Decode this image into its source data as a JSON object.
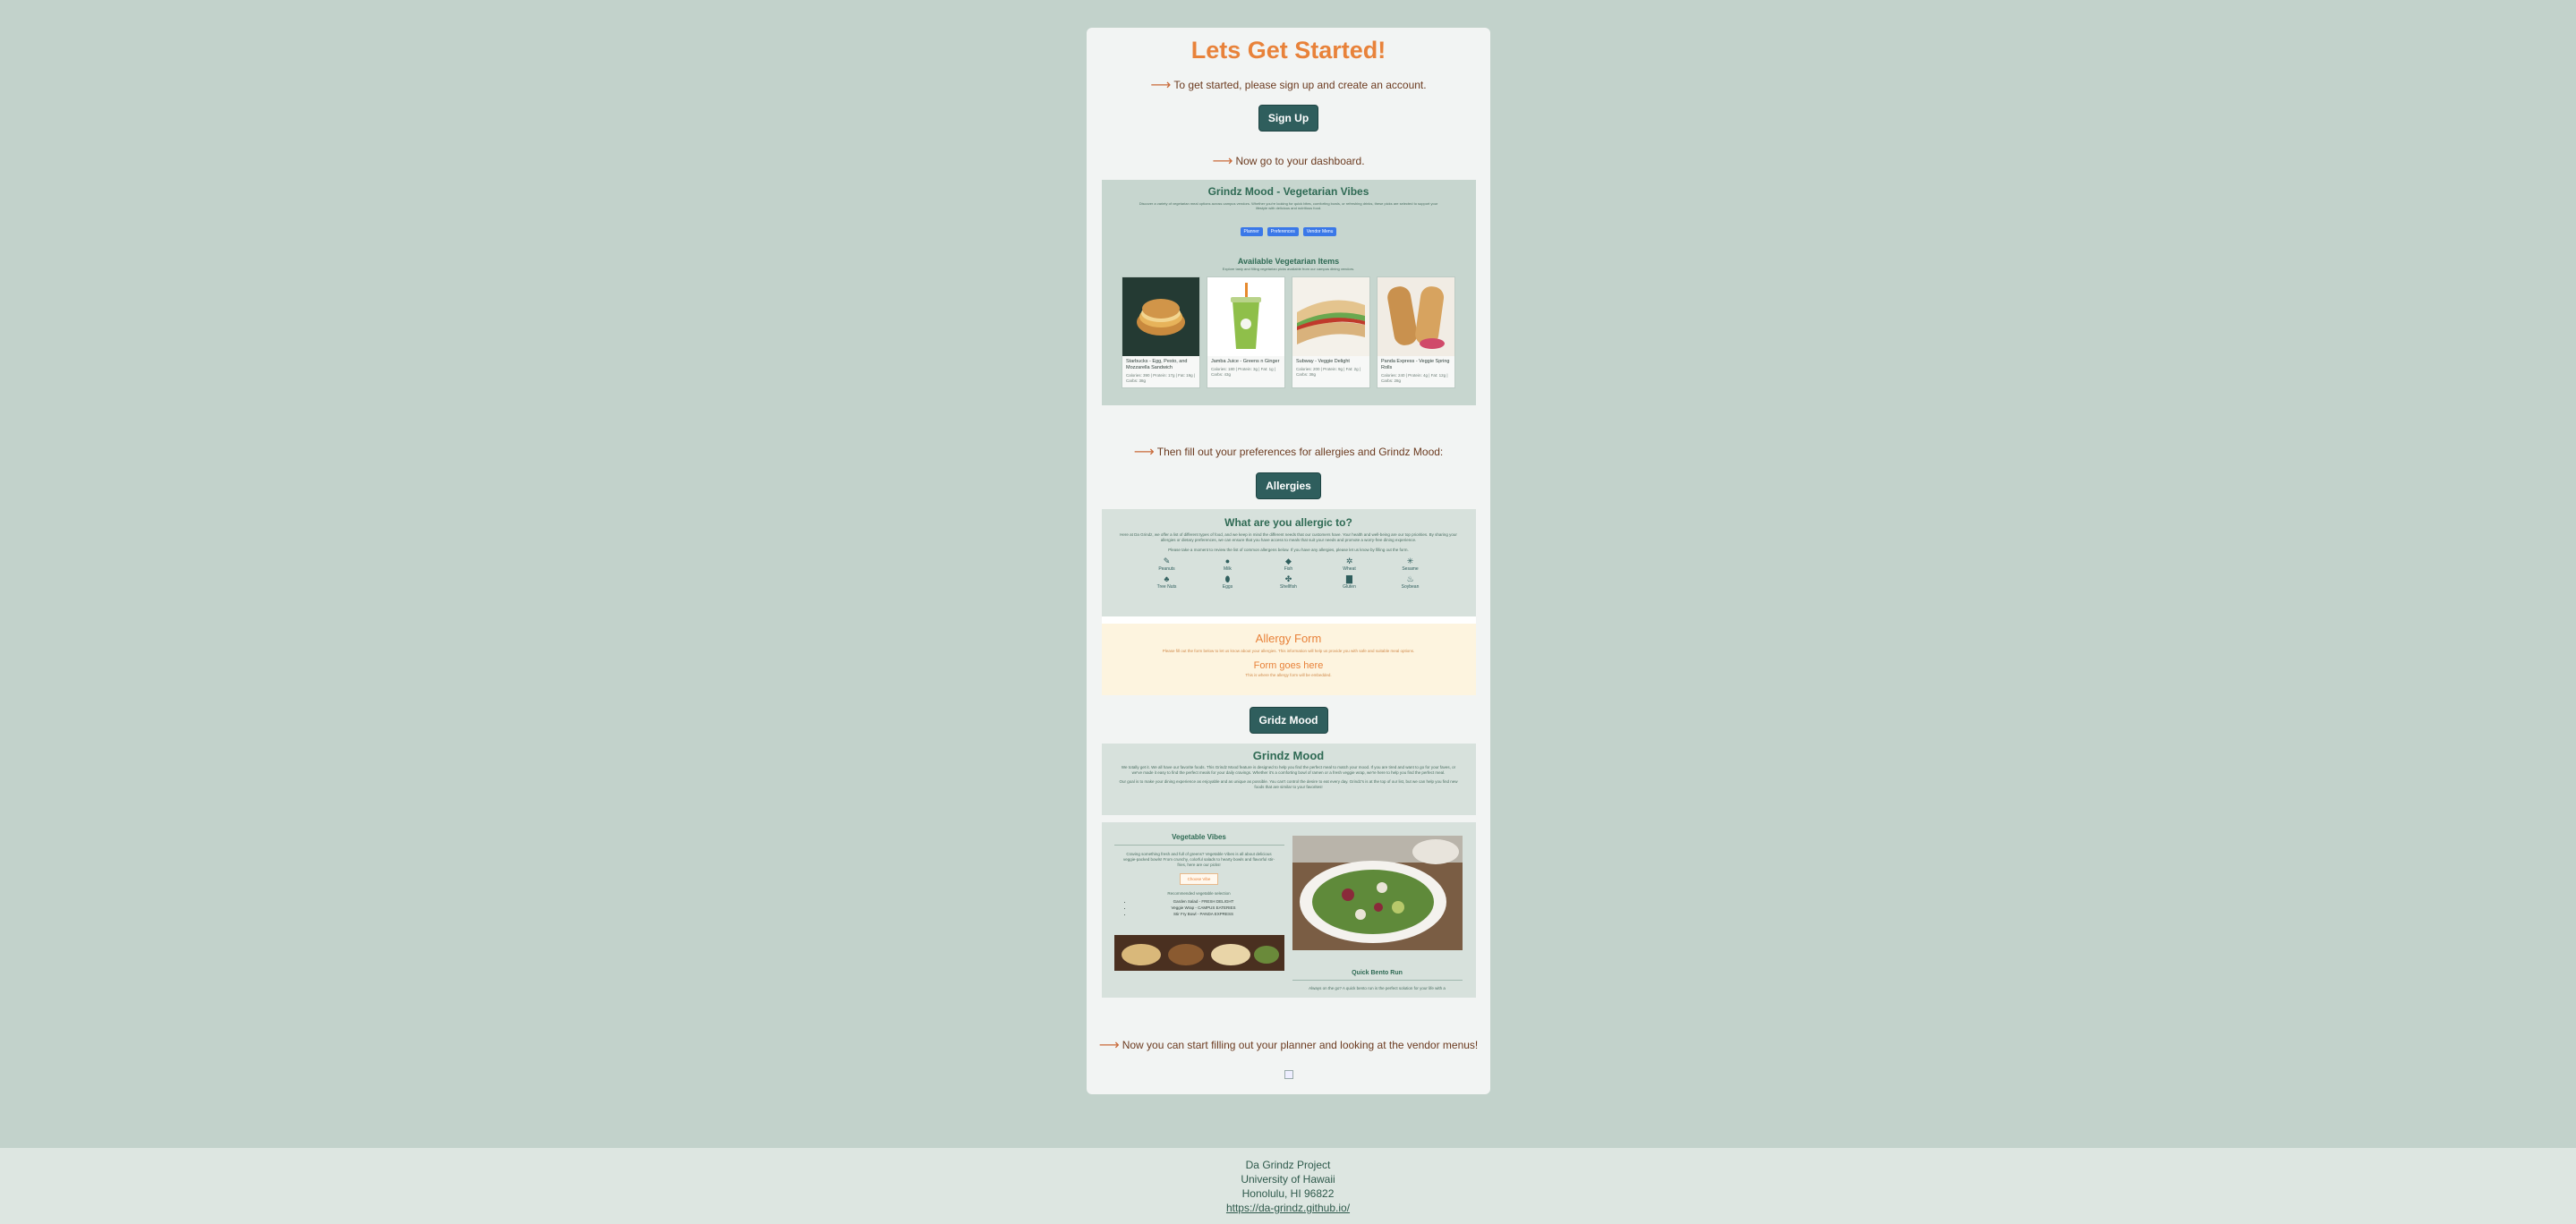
{
  "page": {
    "heading": "Lets Get Started!",
    "step1": "To get started, please sign up and create an account.",
    "signup_button": "Sign Up",
    "step2": "Now go to your dashboard.",
    "step3": "Then fill out your preferences for allergies and Grindz Mood:",
    "allergies_button": "Allergies",
    "gm_button": "Gridz Mood",
    "step4": "Now you can start filling out your planner and looking at the vendor menus!"
  },
  "dashboard": {
    "title": "Grindz Mood - Vegetarian Vibes",
    "intro": "Discover a variety of vegetarian meal options across campus vendors. Whether you're looking for quick bites, comforting bowls, or refreshing drinks, these picks are selected to support your lifestyle with delicious and nutritious food.",
    "chips": [
      "Planner",
      "Preferences",
      "Vendor Menu"
    ],
    "section_title": "Available Vegetarian Items",
    "section_sub": "Explore tasty and filling vegetarian picks available from our campus dining vendors.",
    "items": [
      {
        "name": "Starbucks - Egg, Pesto, and Mozzarella Sandwich",
        "meta": "Calories: 390 | Protein: 17g | Fat: 19g | Carbs: 38g"
      },
      {
        "name": "Jamba Juice - Greens n Ginger",
        "meta": "Calories: 180 | Protein: 3g | Fat: 1g | Carbs: 43g"
      },
      {
        "name": "Subway - Veggie Delight",
        "meta": "Calories: 200 | Protein: 9g | Fat: 2g | Carbs: 38g"
      },
      {
        "name": "Panda Express - Veggie Spring Rolls",
        "meta": "Calories: 240 | Protein: 4g | Fat: 12g | Carbs: 28g"
      }
    ]
  },
  "allergy_panel": {
    "title": "What are you allergic to?",
    "intro": "Here at Da Grindz, we offer a list of different types of food, and we keep in mind the different needs that our customers have. Your health and well-being are our top priorities. By sharing your allergies or dietary preferences, we can ensure that you have access to meals that suit your needs and promote a worry-free dining experience.",
    "note": "Please take a moment to review the list of common allergens below. If you have any allergies, please let us know by filling out the form.",
    "allergens": [
      "Peanuts",
      "Milk",
      "Fish",
      "Wheat",
      "Sesame",
      "Tree Nuts",
      "Eggs",
      "Shellfish",
      "Gluten",
      "Soybean"
    ]
  },
  "allergy_form": {
    "title": "Allergy Form",
    "desc": "Please fill out the form below to let us know about your allergies. This information will help us provide you with safe and suitable meal options.",
    "placeholder": "Form goes here",
    "placeholder_sub": "This is where the allergy form will be embedded."
  },
  "gm_panel": {
    "title": "Grindz Mood",
    "p1": "We totally get it. We all have our favorite foods. This Grindz Mood feature is designed to help you find the perfect meal to match your mood. If you are tired and want to go for your faves, or we've made it easy to find the perfect meals for your daily cravings. Whether it's a comforting bowl of ramen or a fresh veggie wrap, we're here to help you find the perfect meal.",
    "p2": "Our goal is to make your dining experience as enjoyable and as unique as possible. You can't control the desire to eat every day. Grindz's is at the top of our list, but we can help you find new foods that are similar to your favorites!"
  },
  "veggie": {
    "title": "Vegetable Vibes",
    "desc": "Craving something fresh and full of greens? Vegetable Vibes is all about delicious veggie-packed bowls! From crunchy, colorful salads to hearty bowls and flavorful stir-fries, here are our picks!",
    "button": "Choose Vibe",
    "list_title": "Recommended vegetable selection",
    "list": [
      "Garden Salad - FRESH DELIGHT",
      "Veggie Wrap - CAMPUS EATERIES",
      "Stir Fry Bowl - PANDA EXPRESS"
    ],
    "second_title": "Quick Bento Run",
    "second_desc": "Always on the go? A quick bento run is the perfect solution for your life with a"
  },
  "footer": {
    "line1": "Da Grindz Project",
    "line2": "University of Hawaii",
    "line3": "Honolulu, HI 96822",
    "link": "https://da-grindz.github.io/"
  }
}
